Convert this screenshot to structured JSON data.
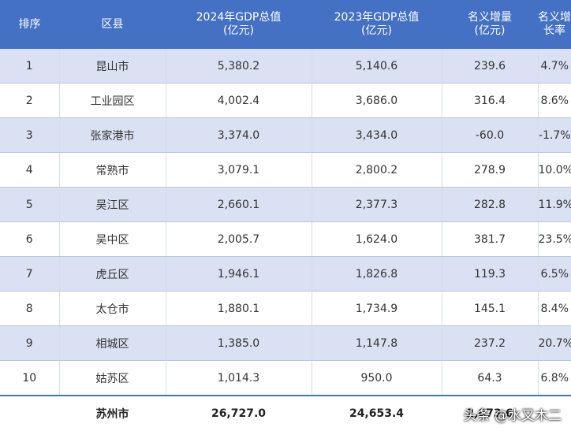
{
  "table": {
    "headers": [
      {
        "line1": "排序",
        "line2": ""
      },
      {
        "line1": "区县",
        "line2": ""
      },
      {
        "line1": "2024年GDP总值",
        "line2": "(亿元)"
      },
      {
        "line1": "2023年GDP总值",
        "line2": "(亿元)"
      },
      {
        "line1": "名义增量",
        "line2": "(亿元)"
      },
      {
        "line1": "名义增长率",
        "line2": ""
      }
    ],
    "rows": [
      [
        "1",
        "昆山市",
        "5,380.2",
        "5,140.6",
        "239.6",
        "4.7%"
      ],
      [
        "2",
        "工业园区",
        "4,002.4",
        "3,686.0",
        "316.4",
        "8.6%"
      ],
      [
        "3",
        "张家港市",
        "3,374.0",
        "3,434.0",
        "-60.0",
        "-1.7%"
      ],
      [
        "4",
        "常熟市",
        "3,079.1",
        "2,800.2",
        "278.9",
        "10.0%"
      ],
      [
        "5",
        "吴江区",
        "2,660.1",
        "2,377.3",
        "282.8",
        "11.9%"
      ],
      [
        "6",
        "吴中区",
        "2,005.7",
        "1,624.0",
        "381.7",
        "23.5%"
      ],
      [
        "7",
        "虎丘区",
        "1,946.1",
        "1,826.8",
        "119.3",
        "6.5%"
      ],
      [
        "8",
        "太仓市",
        "1,880.1",
        "1,734.9",
        "145.1",
        "8.4%"
      ],
      [
        "9",
        "相城区",
        "1,385.0",
        "1,147.8",
        "237.2",
        "20.7%"
      ],
      [
        "10",
        "姑苏区",
        "1,014.3",
        "950.0",
        "64.3",
        "6.8%"
      ]
    ],
    "total": [
      "",
      "苏州市",
      "26,727.0",
      "24,653.4",
      "2,073.6",
      ""
    ]
  },
  "watermark": "头条 @水又木二",
  "colors": {
    "header_bg": "#4471c4",
    "stripe": "#d9e1f2"
  }
}
